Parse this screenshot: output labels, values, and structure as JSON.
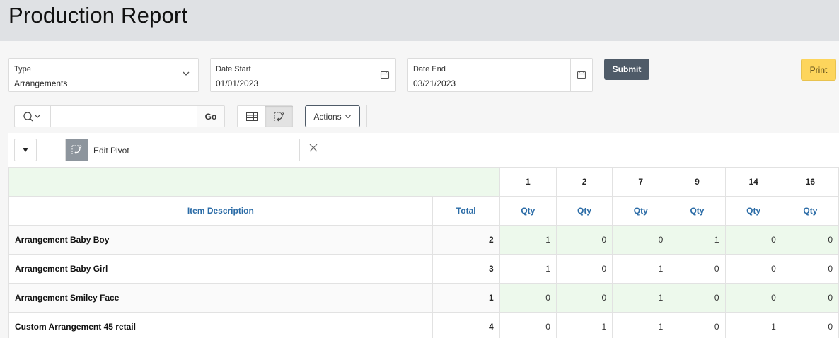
{
  "page": {
    "title": "Production Report"
  },
  "filters": {
    "type": {
      "label": "Type",
      "value": "Arrangements"
    },
    "date_start": {
      "label": "Date Start",
      "value": "01/01/2023"
    },
    "date_end": {
      "label": "Date End",
      "value": "03/21/2023"
    },
    "submit_label": "Submit",
    "print_label": "Print"
  },
  "toolbar": {
    "search_value": "",
    "go_label": "Go",
    "actions_label": "Actions"
  },
  "pivot_chip": {
    "label": "Edit Pivot"
  },
  "colors": {
    "accent": "#4f5b68",
    "print": "#fdd55c",
    "link": "#2a6ba6",
    "highlight": "#edf9ec"
  },
  "table": {
    "pivot_columns": [
      "1",
      "2",
      "7",
      "9",
      "14",
      "16"
    ],
    "headers": {
      "desc": "Item Description",
      "total": "Total",
      "qty": "Qty"
    },
    "rows": [
      {
        "desc": "Arrangement Baby Boy",
        "total": "2",
        "values": [
          "1",
          "0",
          "0",
          "1",
          "0",
          "0"
        ]
      },
      {
        "desc": "Arrangement Baby Girl",
        "total": "3",
        "values": [
          "1",
          "0",
          "1",
          "0",
          "0",
          "0"
        ]
      },
      {
        "desc": "Arrangement Smiley Face",
        "total": "1",
        "values": [
          "0",
          "0",
          "1",
          "0",
          "0",
          "0"
        ]
      },
      {
        "desc": "Custom Arrangement 45 retail",
        "total": "4",
        "values": [
          "0",
          "1",
          "1",
          "0",
          "1",
          "0"
        ]
      }
    ]
  }
}
